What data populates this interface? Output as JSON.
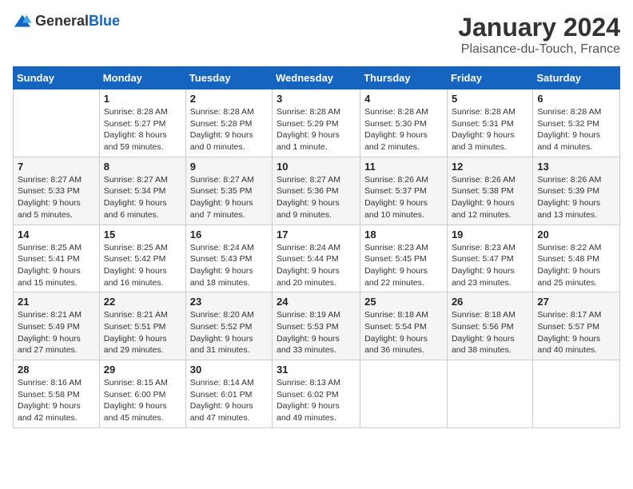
{
  "logo": {
    "text_general": "General",
    "text_blue": "Blue"
  },
  "header": {
    "month": "January 2024",
    "location": "Plaisance-du-Touch, France"
  },
  "days_of_week": [
    "Sunday",
    "Monday",
    "Tuesday",
    "Wednesday",
    "Thursday",
    "Friday",
    "Saturday"
  ],
  "weeks": [
    [
      {
        "day": "",
        "info": ""
      },
      {
        "day": "1",
        "info": "Sunrise: 8:28 AM\nSunset: 5:27 PM\nDaylight: 8 hours\nand 59 minutes."
      },
      {
        "day": "2",
        "info": "Sunrise: 8:28 AM\nSunset: 5:28 PM\nDaylight: 9 hours\nand 0 minutes."
      },
      {
        "day": "3",
        "info": "Sunrise: 8:28 AM\nSunset: 5:29 PM\nDaylight: 9 hours\nand 1 minute."
      },
      {
        "day": "4",
        "info": "Sunrise: 8:28 AM\nSunset: 5:30 PM\nDaylight: 9 hours\nand 2 minutes."
      },
      {
        "day": "5",
        "info": "Sunrise: 8:28 AM\nSunset: 5:31 PM\nDaylight: 9 hours\nand 3 minutes."
      },
      {
        "day": "6",
        "info": "Sunrise: 8:28 AM\nSunset: 5:32 PM\nDaylight: 9 hours\nand 4 minutes."
      }
    ],
    [
      {
        "day": "7",
        "info": "Sunrise: 8:27 AM\nSunset: 5:33 PM\nDaylight: 9 hours\nand 5 minutes."
      },
      {
        "day": "8",
        "info": "Sunrise: 8:27 AM\nSunset: 5:34 PM\nDaylight: 9 hours\nand 6 minutes."
      },
      {
        "day": "9",
        "info": "Sunrise: 8:27 AM\nSunset: 5:35 PM\nDaylight: 9 hours\nand 7 minutes."
      },
      {
        "day": "10",
        "info": "Sunrise: 8:27 AM\nSunset: 5:36 PM\nDaylight: 9 hours\nand 9 minutes."
      },
      {
        "day": "11",
        "info": "Sunrise: 8:26 AM\nSunset: 5:37 PM\nDaylight: 9 hours\nand 10 minutes."
      },
      {
        "day": "12",
        "info": "Sunrise: 8:26 AM\nSunset: 5:38 PM\nDaylight: 9 hours\nand 12 minutes."
      },
      {
        "day": "13",
        "info": "Sunrise: 8:26 AM\nSunset: 5:39 PM\nDaylight: 9 hours\nand 13 minutes."
      }
    ],
    [
      {
        "day": "14",
        "info": "Sunrise: 8:25 AM\nSunset: 5:41 PM\nDaylight: 9 hours\nand 15 minutes."
      },
      {
        "day": "15",
        "info": "Sunrise: 8:25 AM\nSunset: 5:42 PM\nDaylight: 9 hours\nand 16 minutes."
      },
      {
        "day": "16",
        "info": "Sunrise: 8:24 AM\nSunset: 5:43 PM\nDaylight: 9 hours\nand 18 minutes."
      },
      {
        "day": "17",
        "info": "Sunrise: 8:24 AM\nSunset: 5:44 PM\nDaylight: 9 hours\nand 20 minutes."
      },
      {
        "day": "18",
        "info": "Sunrise: 8:23 AM\nSunset: 5:45 PM\nDaylight: 9 hours\nand 22 minutes."
      },
      {
        "day": "19",
        "info": "Sunrise: 8:23 AM\nSunset: 5:47 PM\nDaylight: 9 hours\nand 23 minutes."
      },
      {
        "day": "20",
        "info": "Sunrise: 8:22 AM\nSunset: 5:48 PM\nDaylight: 9 hours\nand 25 minutes."
      }
    ],
    [
      {
        "day": "21",
        "info": "Sunrise: 8:21 AM\nSunset: 5:49 PM\nDaylight: 9 hours\nand 27 minutes."
      },
      {
        "day": "22",
        "info": "Sunrise: 8:21 AM\nSunset: 5:51 PM\nDaylight: 9 hours\nand 29 minutes."
      },
      {
        "day": "23",
        "info": "Sunrise: 8:20 AM\nSunset: 5:52 PM\nDaylight: 9 hours\nand 31 minutes."
      },
      {
        "day": "24",
        "info": "Sunrise: 8:19 AM\nSunset: 5:53 PM\nDaylight: 9 hours\nand 33 minutes."
      },
      {
        "day": "25",
        "info": "Sunrise: 8:18 AM\nSunset: 5:54 PM\nDaylight: 9 hours\nand 36 minutes."
      },
      {
        "day": "26",
        "info": "Sunrise: 8:18 AM\nSunset: 5:56 PM\nDaylight: 9 hours\nand 38 minutes."
      },
      {
        "day": "27",
        "info": "Sunrise: 8:17 AM\nSunset: 5:57 PM\nDaylight: 9 hours\nand 40 minutes."
      }
    ],
    [
      {
        "day": "28",
        "info": "Sunrise: 8:16 AM\nSunset: 5:58 PM\nDaylight: 9 hours\nand 42 minutes."
      },
      {
        "day": "29",
        "info": "Sunrise: 8:15 AM\nSunset: 6:00 PM\nDaylight: 9 hours\nand 45 minutes."
      },
      {
        "day": "30",
        "info": "Sunrise: 8:14 AM\nSunset: 6:01 PM\nDaylight: 9 hours\nand 47 minutes."
      },
      {
        "day": "31",
        "info": "Sunrise: 8:13 AM\nSunset: 6:02 PM\nDaylight: 9 hours\nand 49 minutes."
      },
      {
        "day": "",
        "info": ""
      },
      {
        "day": "",
        "info": ""
      },
      {
        "day": "",
        "info": ""
      }
    ]
  ]
}
